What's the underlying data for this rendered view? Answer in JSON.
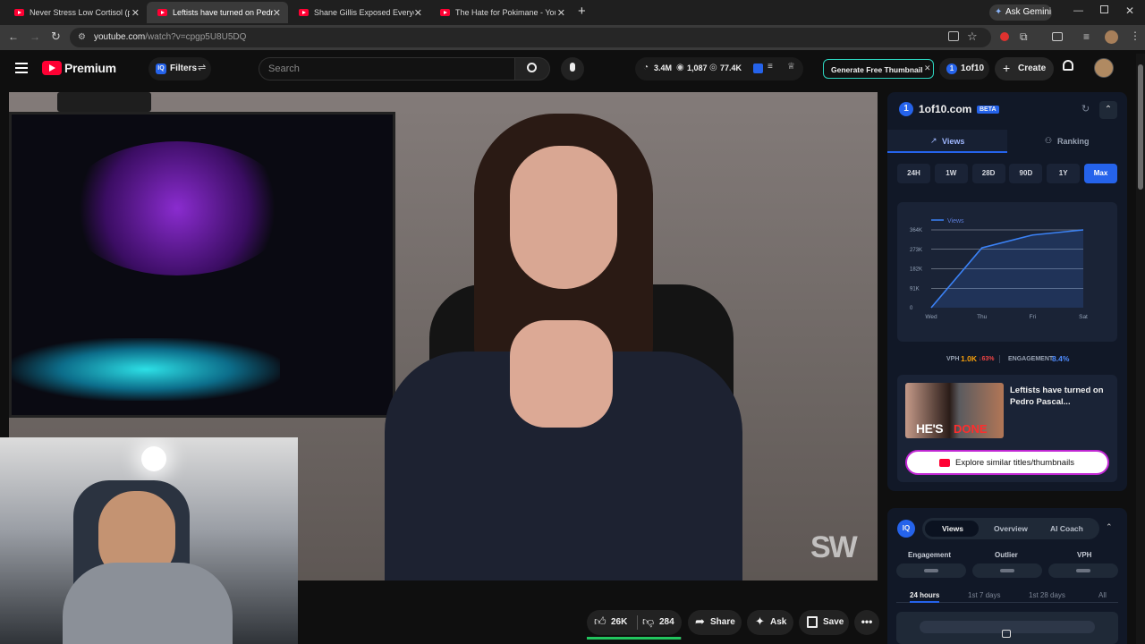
{
  "tabs": [
    {
      "title": "Never Stress Low Cortisol (play",
      "active": false
    },
    {
      "title": "Leftists have turned on Pedro P",
      "active": true
    },
    {
      "title": "Shane Gillis Exposed Everyone",
      "active": false
    },
    {
      "title": "The Hate for Pokimane - YouTu",
      "active": false
    }
  ],
  "new_tab": "+",
  "ask_gemini": "Ask Gemini",
  "url": {
    "host": "youtube.com",
    "path": "/watch?v=cpgp5U8U5DQ"
  },
  "header": {
    "logo": "Premium",
    "filters": "Filters",
    "search_placeholder": "Search",
    "stats": {
      "views": "3.4M",
      "watching": "1,087",
      "likes": "77.4K"
    },
    "generate_thumbnail": "Generate Free Thumbnail",
    "brand": "1of10",
    "create": "Create"
  },
  "video_watermark": "SW",
  "actions": {
    "likes": "26K",
    "dislikes": "284",
    "share": "Share",
    "ask": "Ask",
    "save": "Save"
  },
  "panel1": {
    "title": "1of10.com",
    "beta": "BETA",
    "tab_views": "Views",
    "tab_ranking": "Ranking",
    "ranges": [
      "24H",
      "1W",
      "28D",
      "90D",
      "1Y",
      "Max"
    ],
    "active_range": "Max",
    "vph_label": "VPH",
    "vph_value": "1.0K",
    "vph_change": "↓63%",
    "engagement_label": "ENGAGEMENT",
    "engagement_value": "8.4%",
    "video_title": "Leftists have turned on Pedro Pascal...",
    "thumb_text_a": "HE'S",
    "thumb_text_b": "DONE",
    "explore": "Explore similar titles/thumbnails"
  },
  "chart_data": {
    "type": "line",
    "legend": "Views",
    "x": [
      "Wed",
      "Thu",
      "Fri",
      "Sat"
    ],
    "y_ticks": [
      "0",
      "91K",
      "182K",
      "273K",
      "364K"
    ],
    "ylim": [
      0,
      364000
    ],
    "series": [
      {
        "name": "Views",
        "values": [
          0,
          280000,
          340000,
          365000
        ]
      }
    ]
  },
  "panel2": {
    "tabs": [
      "Views",
      "Overview",
      "AI Coach"
    ],
    "active_tab": "Views",
    "metrics": [
      "Engagement",
      "Outlier",
      "VPH"
    ],
    "periods": [
      "24 hours",
      "1st 7 days",
      "1st 28 days",
      "All"
    ],
    "active_period": "24 hours"
  },
  "colors": {
    "accent": "#2563eb",
    "brand_red": "#ff0033",
    "engagement": "#4f8cff",
    "vph": "#f59e0b"
  }
}
